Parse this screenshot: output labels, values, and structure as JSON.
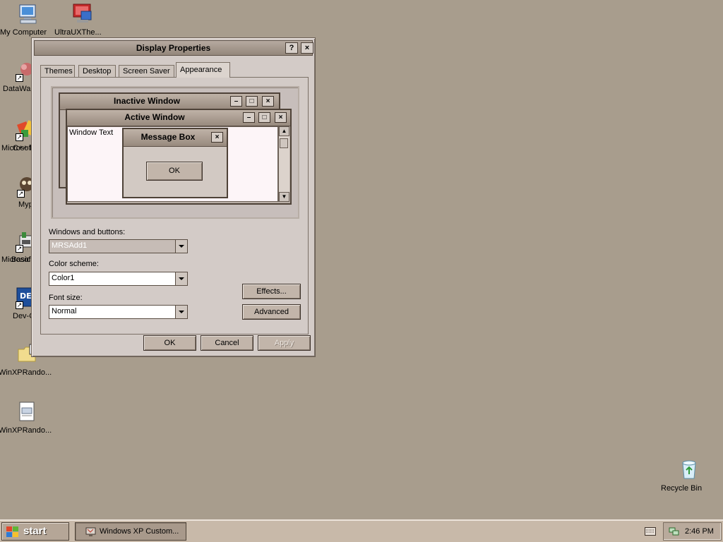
{
  "desktop_icons": [
    {
      "label": "My Computer",
      "icon": "my-computer-icon"
    },
    {
      "label": "UltraUXThe...",
      "icon": "ultraux-theme-icon"
    },
    {
      "label": "DataWa",
      "icon": "datawa-shortcut-icon"
    },
    {
      "label_line1": "Microsof",
      "label_line2": "C++ I",
      "icon": "visual-cpp-shortcut-icon"
    },
    {
      "label": "Myp",
      "icon": "myp-shortcut-icon"
    },
    {
      "label_line1": "Microsof",
      "label_line2": "Basic",
      "icon": "visual-basic-shortcut-icon"
    },
    {
      "label": "Dev-C",
      "icon": "devcpp-shortcut-icon"
    },
    {
      "label": "WinXPRando...",
      "icon": "folder-icon"
    },
    {
      "label": "WinXPRando...",
      "icon": "document-icon"
    },
    {
      "label": "Recycle Bin",
      "icon": "recycle-bin-icon"
    }
  ],
  "dialog": {
    "title": "Display Properties",
    "help_button": "?",
    "close_button": "×",
    "tabs": [
      "Themes",
      "Desktop",
      "Screen Saver",
      "Appearance"
    ],
    "active_tab": "Appearance",
    "preview": {
      "inactive_title": "Inactive Window",
      "active_title": "Active Window",
      "window_text": "Window Text",
      "message_title": "Message Box",
      "message_ok": "OK"
    },
    "windows_buttons_label": "Windows and buttons:",
    "windows_buttons_value": "MRSAdd1",
    "color_scheme_label": "Color scheme:",
    "color_scheme_value": "Color1",
    "font_size_label": "Font size:",
    "font_size_value": "Normal",
    "effects_button": "Effects...",
    "advanced_button": "Advanced",
    "ok_button": "OK",
    "cancel_button": "Cancel",
    "apply_button": "Apply"
  },
  "taskbar": {
    "start_label": "start",
    "task_label": "Windows XP Custom...",
    "clock": "2:46 PM"
  },
  "colors": {
    "desktop": "#a89d8d",
    "taskbar": "#c8b9a9",
    "window_face": "#d3cbc7",
    "window_text_bg": "#fdf5f8"
  }
}
